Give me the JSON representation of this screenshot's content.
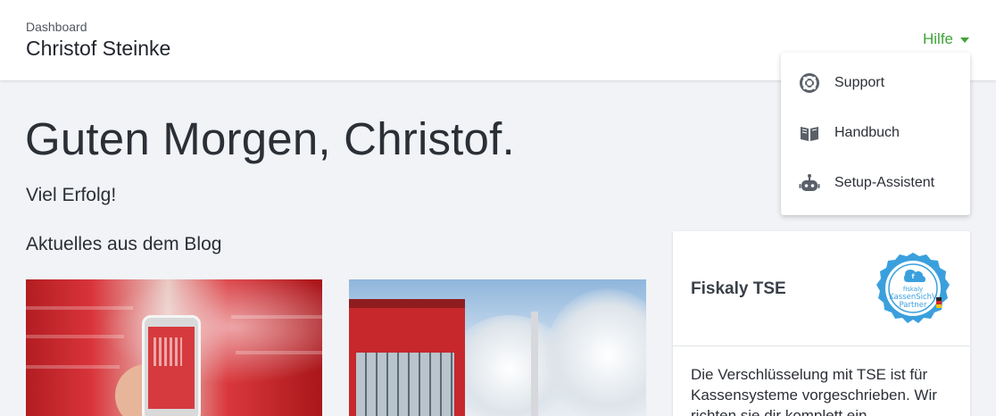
{
  "header": {
    "breadcrumb": "Dashboard",
    "user_name": "Christof Steinke",
    "help_label": "Hilfe"
  },
  "main": {
    "greeting": "Guten Morgen, Christof.",
    "subgreeting": "Viel Erfolg!",
    "blog_heading": "Aktuelles aus dem Blog"
  },
  "help_menu": {
    "items": [
      {
        "label": "Support",
        "icon": "lifebuoy-icon"
      },
      {
        "label": "Handbuch",
        "icon": "book-open-icon"
      },
      {
        "label": "Setup-Assistent",
        "icon": "robot-icon"
      }
    ]
  },
  "tse_card": {
    "title": "Fiskaly TSE",
    "badge": {
      "brand": "fiskaly",
      "line1": "KassenSichV",
      "line2": "Partner"
    },
    "text": "Die Verschlüsselung mit TSE ist für Kassensysteme vorgeschrieben. Wir richten sie dir komplett ein."
  },
  "colors": {
    "accent_green": "#41a33a",
    "badge_blue": "#3aa0dd",
    "page_bg": "#f1f3f6"
  }
}
